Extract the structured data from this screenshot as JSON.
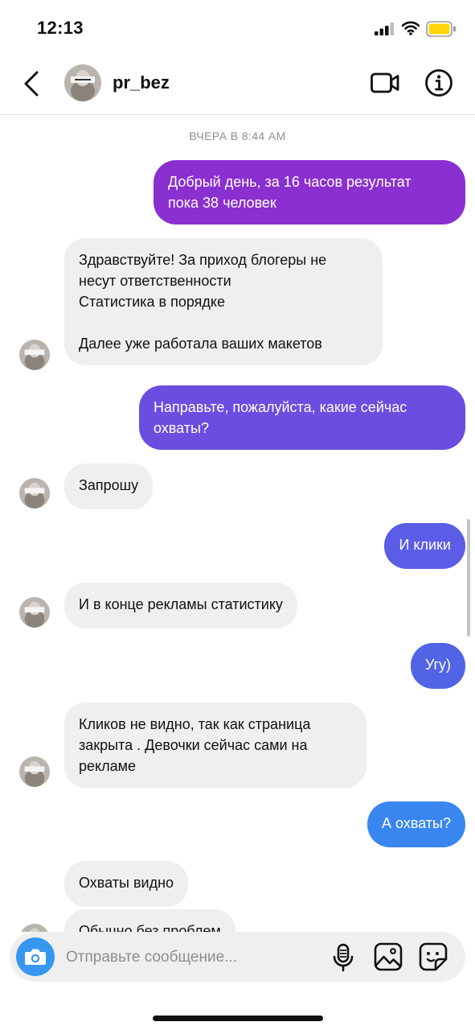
{
  "status": {
    "time": "12:13"
  },
  "header": {
    "username": "pr_bez"
  },
  "chat": {
    "timestamp": "ВЧЕРА В 8:44 AM",
    "messages": [
      {
        "from": "me",
        "text": "Добрый день, за 16 часов результат\nпока 38 человек"
      },
      {
        "from": "them",
        "text": "Здравствуйте! За приход блогеры не\nнесут ответственности\nСтатистика в порядке\n\nДалее уже работала ваших макетов"
      },
      {
        "from": "me",
        "text": "Направьте, пожалуйста, какие сейчас\nохваты?"
      },
      {
        "from": "them",
        "text": "Запрошу"
      },
      {
        "from": "me",
        "text": "И клики"
      },
      {
        "from": "them",
        "text": "И в конце рекламы статистику"
      },
      {
        "from": "me",
        "text": "Угу)"
      },
      {
        "from": "them",
        "text": "Кликов не видно, так как страница\nзакрыта . Девочки сейчас сами на\nрекламе"
      },
      {
        "from": "me",
        "text": "А охваты?"
      },
      {
        "from": "them",
        "text": "Охваты видно"
      },
      {
        "from": "them",
        "text": "Обычно без проблем"
      }
    ]
  },
  "composer": {
    "placeholder": "Отправьте сообщение..."
  },
  "colors": {
    "bubble_purple": "#8a2fd0",
    "bubble_violet": "#6a4ee0",
    "bubble_indigo": "#5b5de6",
    "bubble_blue_violet": "#5164e5",
    "bubble_blue": "#3a86f0",
    "incoming": "#efefef",
    "battery": "#ffd60a"
  },
  "icons": {
    "back": "chevron-left-icon",
    "video": "video-camera-icon",
    "info": "info-icon",
    "camera": "camera-icon",
    "mic": "microphone-icon",
    "gallery": "image-icon",
    "sticker": "sticker-icon"
  }
}
